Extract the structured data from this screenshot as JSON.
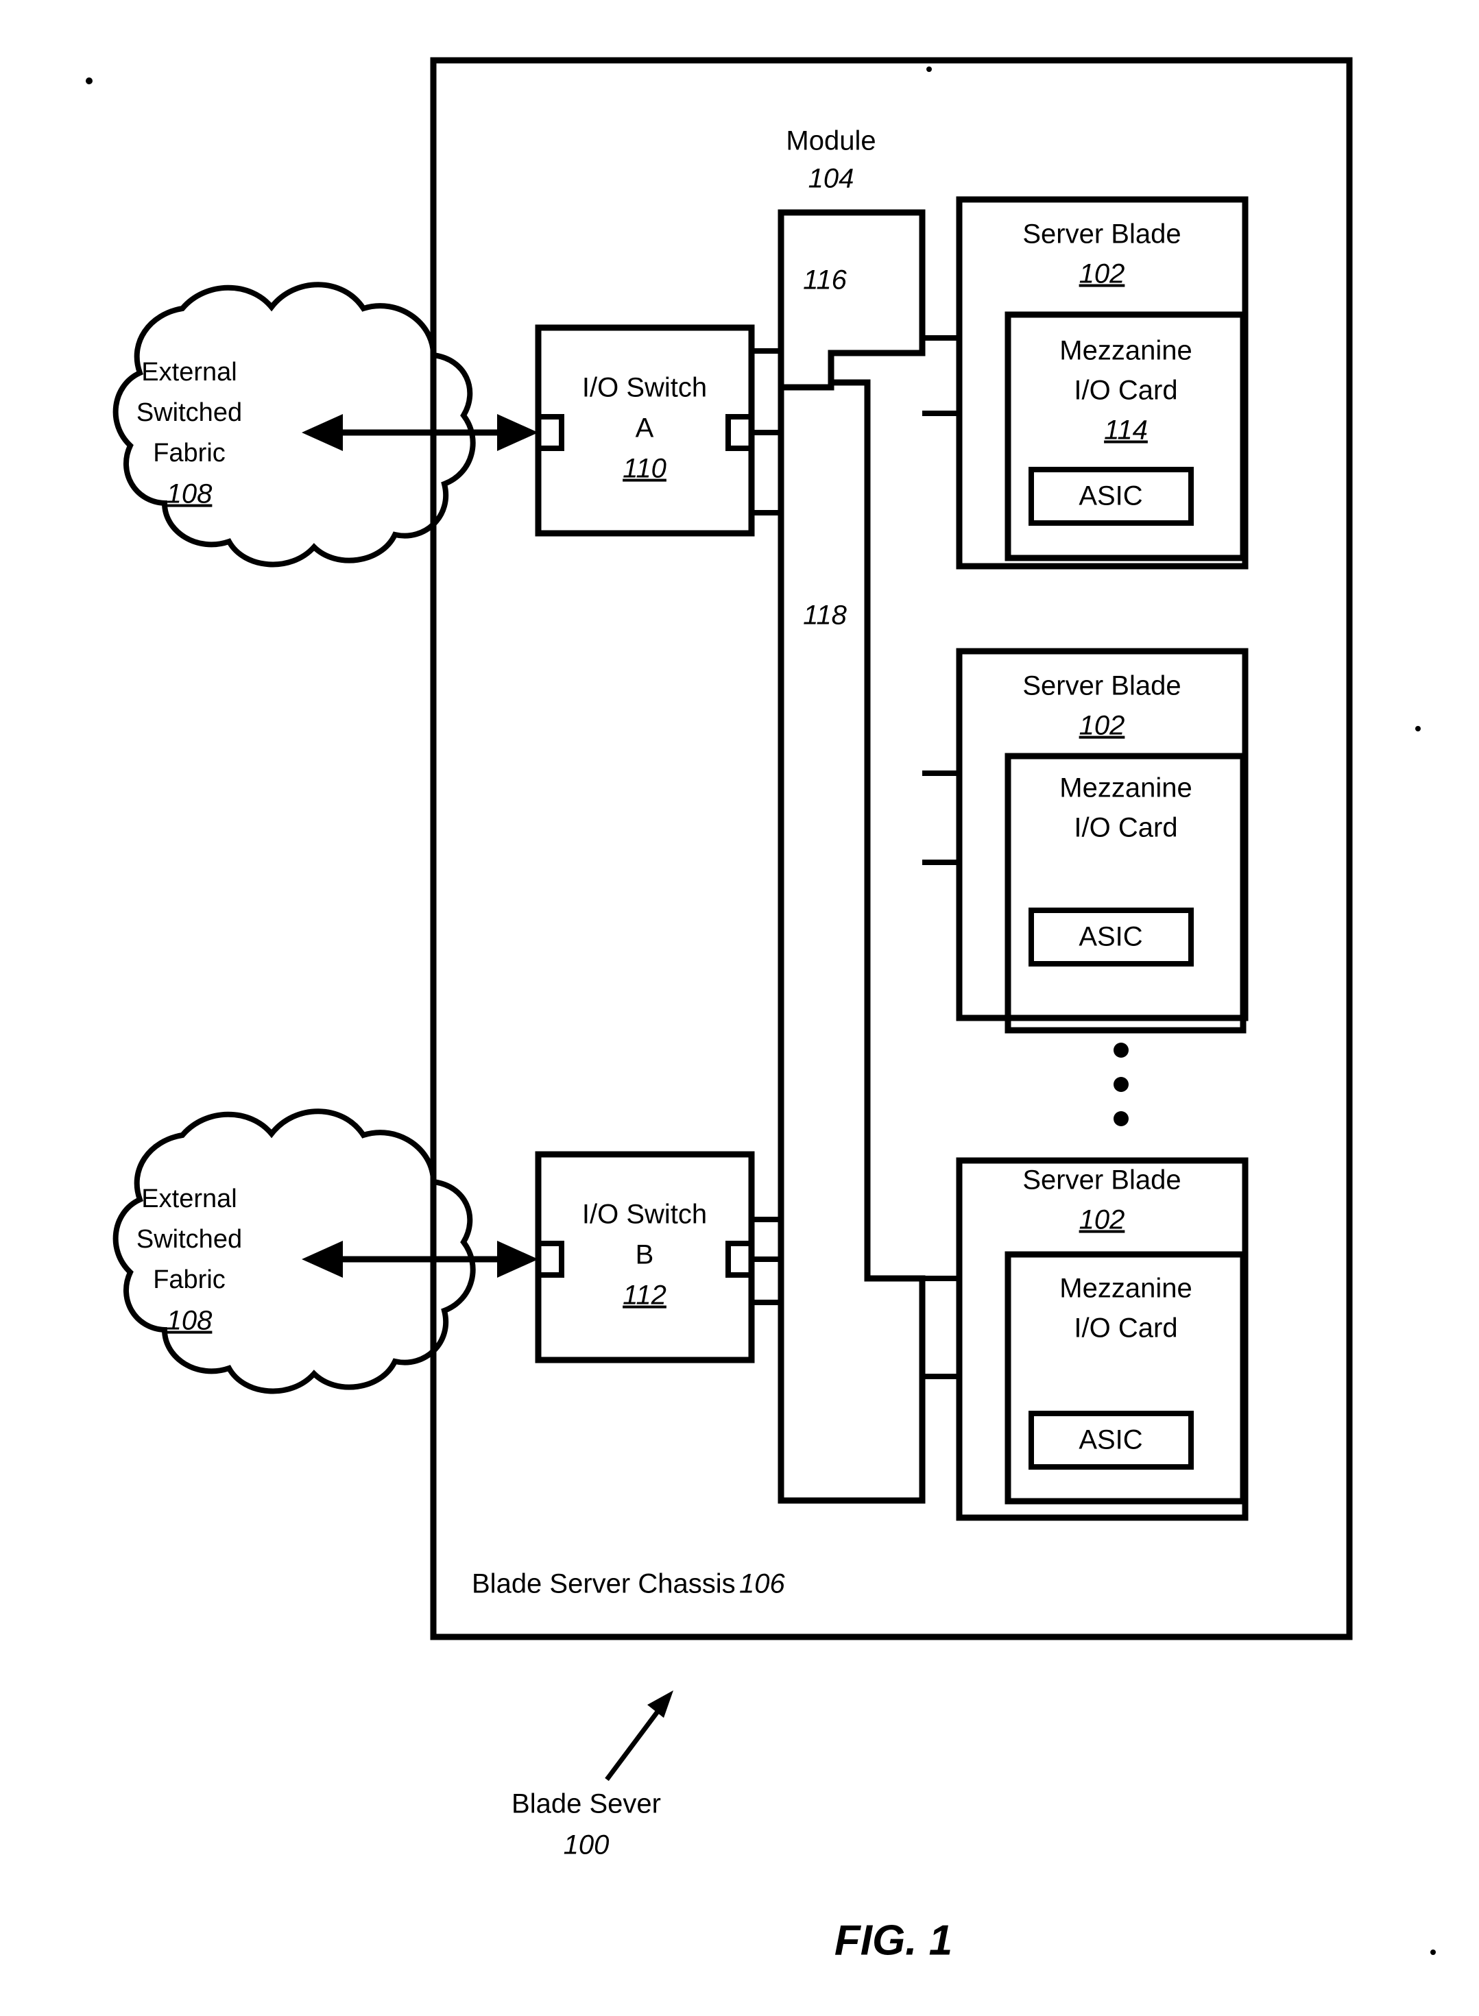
{
  "figure": {
    "caption": "FIG. 1",
    "overall_label": "Blade Sever",
    "overall_ref": "100"
  },
  "chassis": {
    "label": "Blade Server Chassis",
    "ref": "106"
  },
  "module": {
    "label": "Module",
    "ref": "104",
    "upper_channel_ref": "116",
    "lower_channel_ref": "118"
  },
  "fabrics": [
    {
      "line1": "External",
      "line2": "Switched",
      "line3": "Fabric",
      "ref": "108"
    },
    {
      "line1": "External",
      "line2": "Switched",
      "line3": "Fabric",
      "ref": "108"
    }
  ],
  "switches": [
    {
      "line1": "I/O Switch",
      "line2": "A",
      "ref": "110"
    },
    {
      "line1": "I/O Switch",
      "line2": "B",
      "ref": "112"
    }
  ],
  "blades": [
    {
      "title": "Server Blade",
      "ref": "102",
      "card": {
        "line1": "Mezzanine",
        "line2": "I/O Card",
        "ref": "114",
        "asic": "ASIC"
      }
    },
    {
      "title": "Server Blade",
      "ref": "102",
      "card": {
        "line1": "Mezzanine",
        "line2": "I/O Card",
        "ref": "",
        "asic": "ASIC"
      }
    },
    {
      "title": "Server Blade",
      "ref": "102",
      "card": {
        "line1": "Mezzanine",
        "line2": "I/O Card",
        "ref": "",
        "asic": "ASIC"
      }
    }
  ],
  "colors": {
    "ink": "#000000",
    "paper": "#ffffff"
  }
}
